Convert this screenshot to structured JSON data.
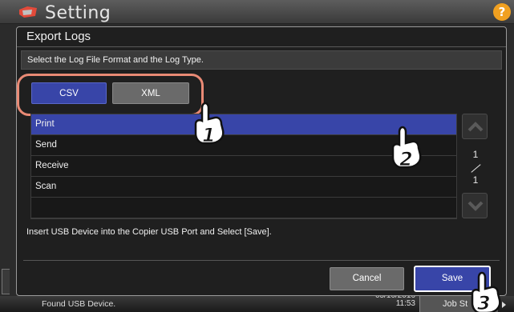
{
  "app": {
    "title": "Setting",
    "help_label": "?",
    "status_message": "Found USB Device.",
    "date_text": "05/16/2016",
    "time_text": "11:53",
    "job_status_label": "Job St"
  },
  "dialog": {
    "title": "Export Logs",
    "instruction": "Select the Log File Format and the Log Type.",
    "format_buttons": [
      {
        "label": "CSV",
        "selected": true
      },
      {
        "label": "XML",
        "selected": false
      }
    ],
    "log_types": [
      {
        "label": "Print",
        "selected": true
      },
      {
        "label": "Send",
        "selected": false
      },
      {
        "label": "Receive",
        "selected": false
      },
      {
        "label": "Scan",
        "selected": false
      },
      {
        "label": "",
        "selected": false
      }
    ],
    "page": {
      "current": "1",
      "total": "1"
    },
    "hint": "Insert USB Device into the Copier USB Port and Select [Save].",
    "cancel_label": "Cancel",
    "save_label": "Save"
  },
  "step_markers": [
    "1",
    "2",
    "3"
  ],
  "colors": {
    "accent": "#3845a8",
    "highlight_outline": "#e98a75",
    "dialog_bg": "#1f1f1f",
    "help_icon": "#f0a020"
  }
}
